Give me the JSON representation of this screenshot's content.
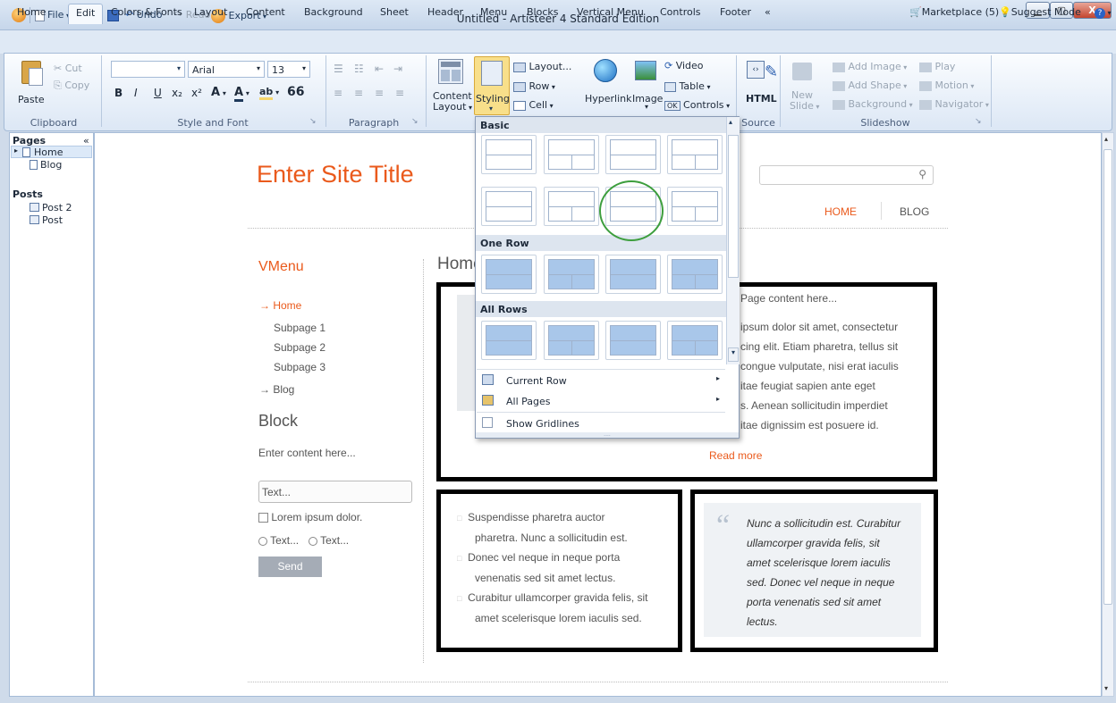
{
  "window": {
    "title": "Untitled - Artisteer 4 Standard Edition"
  },
  "quick_access": {
    "file": "File",
    "undo": "Undo",
    "redo": "Redo",
    "export": "Export"
  },
  "window_buttons": {
    "minimize": "▁",
    "maximize": "▢",
    "close": "X"
  },
  "tabs": [
    "Home",
    "Edit",
    "Colors & Fonts",
    "Layout",
    "Content",
    "Background",
    "Sheet",
    "Header",
    "Menu",
    "Blocks",
    "Vertical Menu",
    "Controls",
    "Footer",
    "«"
  ],
  "active_tab": "Edit",
  "topright": {
    "marketplace": "Marketplace (5)",
    "suggest": "Suggest Mode"
  },
  "ribbon": {
    "clipboard": {
      "paste": "Paste",
      "cut": "Cut",
      "copy": "Copy",
      "group": "Clipboard"
    },
    "style_font": {
      "font": "Arial",
      "size": "13",
      "group": "Style and Font",
      "bold": "B",
      "italic": "I",
      "underline": "U",
      "sub": "x₂",
      "sup": "x²",
      "quote": "66"
    },
    "paragraph": {
      "group": "Paragraph"
    },
    "content_layout": {
      "label1": "Content",
      "label2": "Layout",
      "styling": "Styling",
      "layout_btn": "Layout...",
      "row": "Row",
      "cell": "Cell"
    },
    "insert": {
      "hyperlink": "Hyperlink",
      "image": "Image",
      "video": "Video",
      "table": "Table",
      "controls": "Controls"
    },
    "source": {
      "html": "HTML",
      "group": "Source"
    },
    "slideshow": {
      "new_slide1": "New",
      "new_slide2": "Slide",
      "add_image": "Add Image",
      "add_shape": "Add Shape",
      "background": "Background",
      "play": "Play",
      "motion": "Motion",
      "navigator": "Navigator",
      "group": "Slideshow"
    }
  },
  "left_panel": {
    "pages_title": "Pages",
    "pages": [
      "Home",
      "Blog"
    ],
    "posts_title": "Posts",
    "posts": [
      "Post 2",
      "Post"
    ],
    "collapse": "«"
  },
  "site": {
    "title": "Enter Site Title",
    "nav": [
      "HOME",
      "BLOG"
    ],
    "vmenu_title": "VMenu",
    "vmenu": {
      "home": "→ Home",
      "sub": [
        "Subpage 1",
        "Subpage 2",
        "Subpage 3"
      ],
      "blog": "→ Blog"
    },
    "block_title": "Block",
    "block_text": "Enter content here...",
    "form": {
      "text_input": "Text...",
      "checkbox": "Lorem ipsum dolor.",
      "radio1": "Text...",
      "radio2": "Text...",
      "send": "Send"
    },
    "content_title": "Home",
    "page_content": "Page content here...",
    "lorem": [
      "ipsum dolor sit amet, consectetur",
      "cing elit. Etiam pharetra, tellus sit",
      "congue vulputate, nisi erat iaculis",
      "itae feugiat sapien ante eget",
      "s. Aenean sollicitudin imperdiet",
      "itae dignissim est posuere id."
    ],
    "read_more": "Read more",
    "list": [
      "Suspendisse pharetra auctor",
      "pharetra. Nunc a sollicitudin est.",
      "Donec vel neque in neque porta",
      "venenatis sed sit amet lectus.",
      "Curabitur ullamcorper gravida felis, sit",
      "amet scelerisque lorem iaculis sed."
    ],
    "quote_mark": "“",
    "quote": [
      "Nunc a sollicitudin est. Curabitur",
      "ullamcorper gravida felis, sit",
      "amet scelerisque lorem iaculis",
      "sed. Donec vel neque in neque",
      "porta venenatis sed sit amet",
      "lectus."
    ]
  },
  "dropdown": {
    "basic": "Basic",
    "one_row": "One Row",
    "all_rows": "All Rows",
    "current_row": "Current Row",
    "all_pages": "All Pages",
    "show_gridlines": "Show Gridlines"
  },
  "colors": {
    "accent": "#ea5a1c",
    "ribbon": "#dce7f5",
    "highlight": "#f5d56b"
  }
}
